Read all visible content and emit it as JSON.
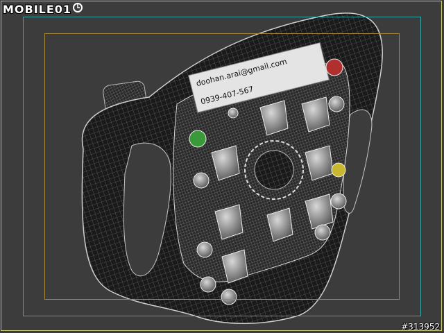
{
  "watermark": {
    "brand": "MOBILE01"
  },
  "post_id": "#313952",
  "nameplate": {
    "email": "doohan.arai@gmail.com",
    "phone": "0939-407-567"
  },
  "colors": {
    "background": "#3c3c3c",
    "wireframe": "#c8c8c8",
    "frame_outer": "#c8c870",
    "frame_safe": "#3aa6a6",
    "frame_title": "#a88a3a",
    "button_green": "#3a9a3a",
    "button_red": "#b03030",
    "button_yellow": "#c8b830"
  },
  "icons": [
    "mobile01-logo-icon"
  ]
}
